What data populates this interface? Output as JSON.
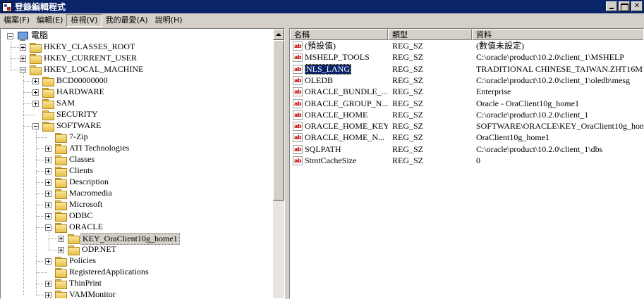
{
  "window": {
    "title": "登錄編輯程式"
  },
  "menu": [
    "檔案(F)",
    "編輯(E)",
    "檢視(V)",
    "我的最愛(A)",
    "說明(H)"
  ],
  "tree": {
    "root": "電腦",
    "items": [
      "HKEY_CLASSES_ROOT",
      "HKEY_CURRENT_USER",
      "HKEY_LOCAL_MACHINE",
      "BCD00000000",
      "HARDWARE",
      "SAM",
      "SECURITY",
      "SOFTWARE",
      "7-Zip",
      "ATI Technologies",
      "Classes",
      "Clients",
      "Description",
      "Macromedia",
      "Microsoft",
      "ODBC",
      "ORACLE",
      "KEY_OraClient10g_home1",
      "ODP.NET",
      "Policies",
      "RegisteredApplications",
      "ThinPrint",
      "VAMMonitor"
    ],
    "selected": "KEY_OraClient10g_home1"
  },
  "list": {
    "columns": [
      "名稱",
      "類型",
      "資料"
    ],
    "rows": [
      {
        "name": "(預設值)",
        "type": "REG_SZ",
        "data": "(數值未設定)"
      },
      {
        "name": "MSHELP_TOOLS",
        "type": "REG_SZ",
        "data": "C:\\oracle\\product\\10.2.0\\client_1\\MSHELP"
      },
      {
        "name": "NLS_LANG",
        "type": "REG_SZ",
        "data": "TRADITIONAL CHINESE_TAIWAN.ZHT16MS"
      },
      {
        "name": "OLEDB",
        "type": "REG_SZ",
        "data": "C:\\oracle\\product\\10.2.0\\client_1\\oledb\\mesg"
      },
      {
        "name": "ORACLE_BUNDLE_...",
        "type": "REG_SZ",
        "data": "Enterprise"
      },
      {
        "name": "ORACLE_GROUP_N...",
        "type": "REG_SZ",
        "data": "Oracle - OraClient10g_home1"
      },
      {
        "name": "ORACLE_HOME",
        "type": "REG_SZ",
        "data": "C:\\oracle\\product\\10.2.0\\client_1"
      },
      {
        "name": "ORACLE_HOME_KEY",
        "type": "REG_SZ",
        "data": "SOFTWARE\\ORACLE\\KEY_OraClient10g_hom"
      },
      {
        "name": "ORACLE_HOME_N...",
        "type": "REG_SZ",
        "data": "OraClient10g_home1"
      },
      {
        "name": "SQLPATH",
        "type": "REG_SZ",
        "data": "C:\\oracle\\product\\10.2.0\\client_1\\dbs"
      },
      {
        "name": "StmtCacheSize",
        "type": "REG_SZ",
        "data": "0"
      }
    ],
    "selected_row": "NLS_LANG",
    "value_icon": "ab-string-icon"
  }
}
